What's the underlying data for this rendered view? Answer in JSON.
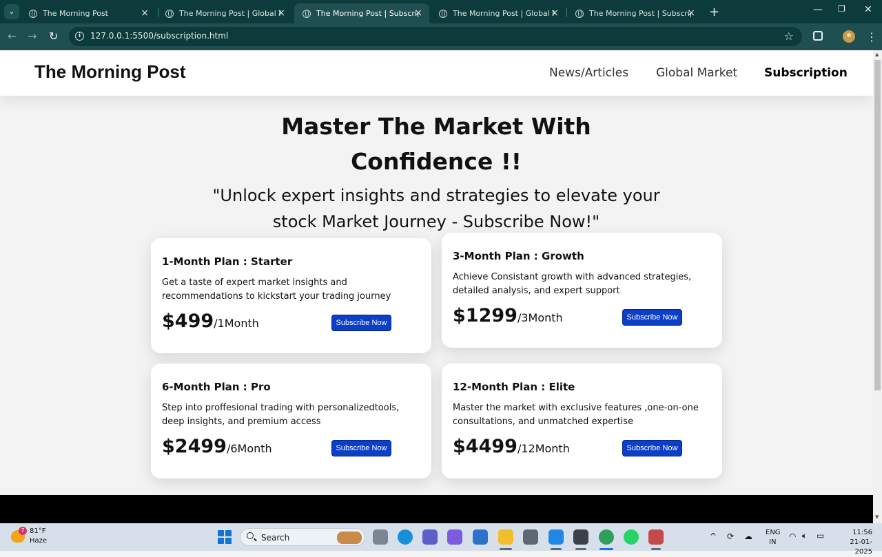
{
  "browser": {
    "tabs": [
      {
        "title": "The Morning Post",
        "active": false
      },
      {
        "title": "The Morning Post | Global Mark",
        "active": false
      },
      {
        "title": "The Morning Post | Subscription",
        "active": true
      },
      {
        "title": "The Morning Post | Global Mark",
        "active": false
      },
      {
        "title": "The Morning Post | Subscription",
        "active": false
      }
    ],
    "url": "127.0.0.1:5500/subscription.html"
  },
  "site": {
    "brand": "The Morning Post",
    "nav": [
      {
        "label": "News/Articles",
        "active": false
      },
      {
        "label": "Global Market",
        "active": false
      },
      {
        "label": "Subscription",
        "active": true
      }
    ],
    "hero_title_line1": "Master The Market With",
    "hero_title_line2": "Confidence !!",
    "hero_sub_line1": "\"Unlock expert insights and strategies to elevate your",
    "hero_sub_line2": "stock Market Journey - Subscribe Now!\"",
    "plans": [
      {
        "name": "1-Month Plan : Starter",
        "description": "Get a taste of expert market insights and recommendations to kickstart your trading journey",
        "price": "$499",
        "period": "/1Month",
        "button": "Subscribe Now"
      },
      {
        "name": "3-Month Plan : Growth",
        "description": "Achieve Consistant growth with advanced strategies, detailed analysis, and expert support",
        "price": "$1299",
        "period": "/3Month",
        "button": "Subscribe Now"
      },
      {
        "name": "6-Month Plan : Pro",
        "description": "Step into proffesional trading with personalizedtools, deep insights, and premium access",
        "price": "$2499",
        "period": "/6Month",
        "button": "Subscribe Now"
      },
      {
        "name": "12-Month Plan : Elite",
        "description": "Master the market with exclusive features ,one-on-one consultations, and unmatched expertise",
        "price": "$4499",
        "period": "/12Month",
        "button": "Subscribe Now"
      }
    ]
  },
  "taskbar": {
    "weather_temp": "81°F",
    "weather_desc": "Haze",
    "weather_badge": "7",
    "search_label": "Search",
    "lang_line1": "ENG",
    "lang_line2": "IN",
    "time": "11:56",
    "date": "21-01-2025"
  },
  "colors": {
    "browser_frame": "#0d3b3b",
    "toolbar": "#1f4f50",
    "subscribe_button": "#0b3fc7",
    "page_background": "#f3f3f3",
    "footer": "#000000"
  }
}
